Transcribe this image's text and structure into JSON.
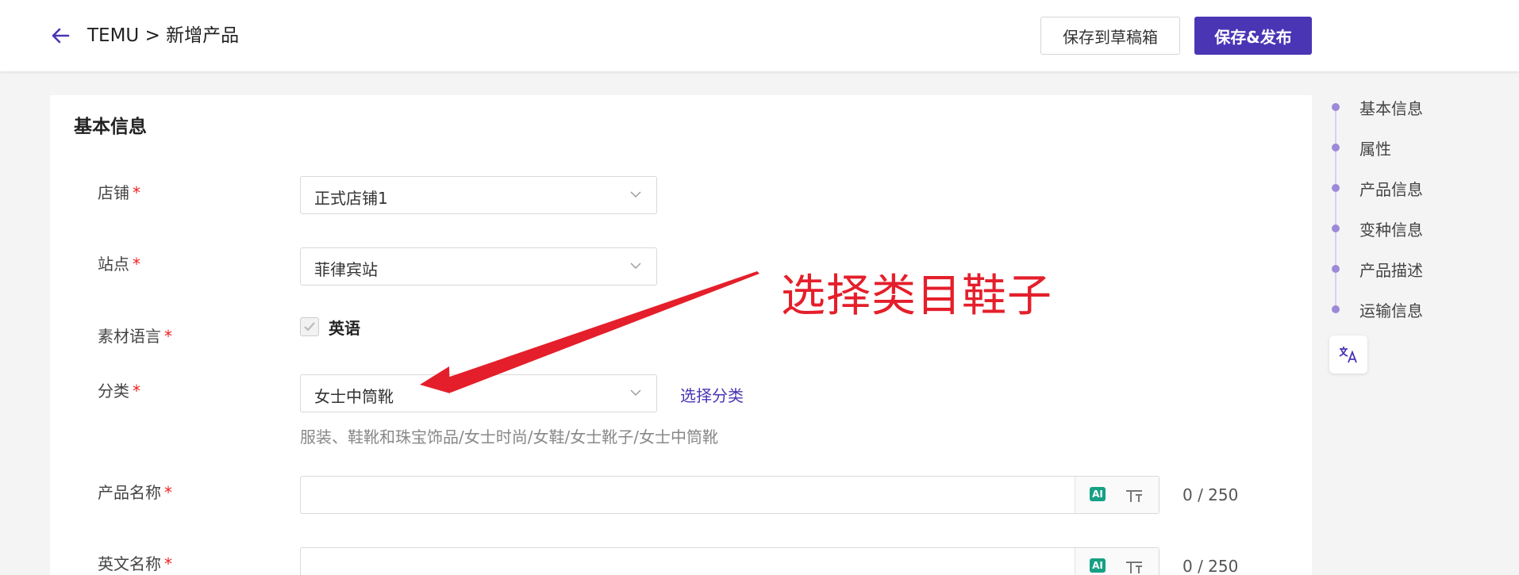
{
  "header": {
    "breadcrumb": "TEMU > 新增产品",
    "save_draft_label": "保存到草稿箱",
    "save_publish_label": "保存&发布"
  },
  "section": {
    "title": "基本信息"
  },
  "form": {
    "store": {
      "label": "店铺",
      "value": "正式店铺1"
    },
    "site": {
      "label": "站点",
      "value": "菲律宾站"
    },
    "material_language": {
      "label": "素材语言",
      "option_label": "英语",
      "checked": true
    },
    "category": {
      "label": "分类",
      "value": "女士中筒靴",
      "select_link": "选择分类",
      "path": "服装、鞋靴和珠宝饰品/女士时尚/女鞋/女士靴子/女士中筒靴"
    },
    "product_name": {
      "label": "产品名称",
      "value": "",
      "counter": "0 / 250"
    },
    "english_name": {
      "label": "英文名称",
      "value": "",
      "counter": "0 / 250"
    },
    "required_mark": "*",
    "ai_label": "AI"
  },
  "annotation": {
    "text": "选择类目鞋子"
  },
  "side_nav": {
    "items": [
      {
        "label": "基本信息"
      },
      {
        "label": "属性"
      },
      {
        "label": "产品信息"
      },
      {
        "label": "变种信息"
      },
      {
        "label": "产品描述"
      },
      {
        "label": "运输信息"
      }
    ]
  },
  "colors": {
    "brand": "#4a35b5",
    "required": "#e22222",
    "annotation": "#e41f2b",
    "ai_badge": "#16a085"
  }
}
